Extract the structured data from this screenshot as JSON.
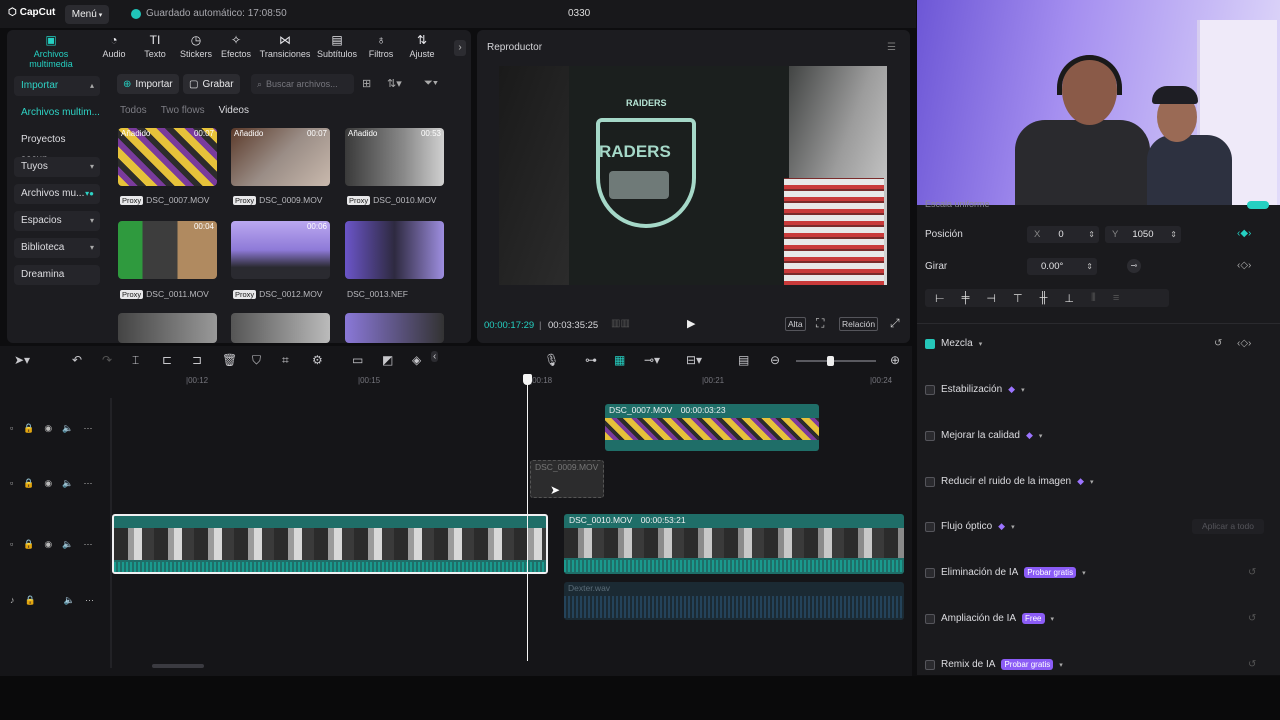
{
  "app": {
    "logo": "CapCut",
    "menu_label": "Menú",
    "autosave": "Guardado automático: 17:08:50",
    "project_title": "0330"
  },
  "tool_tabs": [
    {
      "label": "Archivos multimedia",
      "icon": "media-icon",
      "active": true
    },
    {
      "label": "Audio",
      "icon": "audio-icon"
    },
    {
      "label": "Texto",
      "icon": "text-icon"
    },
    {
      "label": "Stickers",
      "icon": "sticker-icon"
    },
    {
      "label": "Efectos",
      "icon": "effects-icon"
    },
    {
      "label": "Transiciones",
      "icon": "transitions-icon"
    },
    {
      "label": "Subtítulos",
      "icon": "subtitles-icon"
    },
    {
      "label": "Filtros",
      "icon": "filters-icon"
    },
    {
      "label": "Ajuste",
      "icon": "adjust-icon"
    }
  ],
  "sidebar": {
    "items": [
      {
        "label": "Importar"
      },
      {
        "label": "Archivos multim..."
      },
      {
        "label": "Proyectos secun..."
      },
      {
        "label": "Tuyos"
      },
      {
        "label": "Archivos mu..."
      },
      {
        "label": "Espacios"
      },
      {
        "label": "Biblioteca"
      },
      {
        "label": "Dreamina"
      }
    ]
  },
  "media_toolbar": {
    "import_label": "Importar",
    "record_label": "Grabar",
    "search_placeholder": "Buscar archivos..."
  },
  "filters": [
    "Todos",
    "Two flows",
    "Videos"
  ],
  "media_items": [
    {
      "name": "DSC_0007.MOV",
      "badge": "Añadido",
      "duration": "00:07",
      "proxy": "Proxy"
    },
    {
      "name": "DSC_0009.MOV",
      "badge": "Añadido",
      "duration": "00:07",
      "proxy": "Proxy"
    },
    {
      "name": "DSC_0010.MOV",
      "badge": "Añadido",
      "duration": "00:53",
      "proxy": "Proxy"
    },
    {
      "name": "DSC_0011.MOV",
      "badge": "",
      "duration": "00:04",
      "proxy": "Proxy"
    },
    {
      "name": "DSC_0012.MOV",
      "badge": "",
      "duration": "00:06",
      "proxy": "Proxy"
    },
    {
      "name": "DSC_0013.NEF",
      "badge": "",
      "duration": "",
      "proxy": ""
    }
  ],
  "player": {
    "title": "Reproductor",
    "current_time": "00:00:17:29",
    "total_time": "00:03:35:25",
    "quality_label": "Alta",
    "ratio_label": "Relación",
    "video_text": "RAIDERS",
    "shield_text": "RADERS"
  },
  "properties": {
    "section_label": "Escala uniforme",
    "position_label": "Posición",
    "position_x_label": "X",
    "position_x": "0",
    "position_y_label": "Y",
    "position_y": "1050",
    "rotate_label": "Girar",
    "rotate_value": "0.00°",
    "blend_label": "Mezcla",
    "stabilize_label": "Estabilización",
    "quality_label": "Mejorar la calidad",
    "denoise_label": "Reducir el ruido de la imagen",
    "optical_flow_label": "Flujo óptico",
    "apply_all_label": "Aplicar a todo",
    "ai_remove_label": "Eliminación de IA",
    "ai_remove_badge": "Probar gratis",
    "ai_expand_label": "Ampliación de IA",
    "ai_expand_badge": "Free",
    "ai_remix_label": "Remix de IA",
    "ai_remix_badge": "Probar gratis"
  },
  "timeline": {
    "ruler_ticks": [
      "00:12",
      "00:15",
      "00:18",
      "00:21",
      "00:24"
    ],
    "clip_top": {
      "name": "DSC_0007.MOV",
      "duration": "00:00:03:23"
    },
    "clip_ghost": {
      "name": "DSC_0009.MOV"
    },
    "clip_main_right": {
      "name": "DSC_0010.MOV",
      "duration": "00:00:53:21"
    },
    "audio_clip": {
      "name": "Dexter.wav"
    }
  },
  "colors": {
    "accent": "#25d0c2",
    "clip_teal": "#1f6e68",
    "ai_badge": "#8b5cf6"
  }
}
